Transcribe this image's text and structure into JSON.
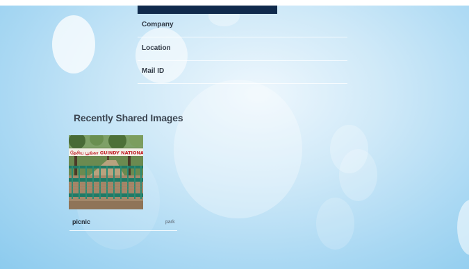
{
  "profile_fields": [
    {
      "label": "Company"
    },
    {
      "label": "Location"
    },
    {
      "label": "Mail ID"
    }
  ],
  "shared_images": {
    "title": "Recently Shared Images",
    "items": [
      {
        "caption": "picnic",
        "tag": "park",
        "photo_sign_text": "தேசிய பூங்கா   GUINDY NATIONAL PARK"
      }
    ]
  },
  "colors": {
    "header_bar": "#102a4c",
    "background": "#a9d8f3"
  }
}
